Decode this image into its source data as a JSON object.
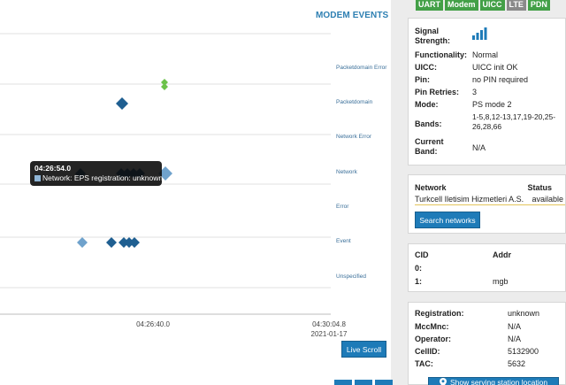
{
  "events": {
    "title": "MODEM EVENTS",
    "rows": [
      "Packetdomain Error",
      "Packetdomain",
      "Network Error",
      "Network",
      "Error",
      "Event",
      "Unspecified"
    ],
    "x_ticks": [
      "04:26:40.0",
      "04:30:04.8"
    ],
    "x_date": "2021-01-17",
    "tooltip": {
      "time": "04:26:54.0",
      "text": "Network: EPS registration: unknown"
    },
    "live_scroll": "Live Scroll",
    "colors": {
      "marker": "#1f5f91",
      "marker_light": "#6fa2cc",
      "marker_green": "#6cc24a",
      "grid": "#e2e2e2"
    }
  },
  "badges": [
    {
      "label": "UART",
      "active": true
    },
    {
      "label": "Modem",
      "active": true
    },
    {
      "label": "UICC",
      "active": true
    },
    {
      "label": "LTE",
      "active": false
    },
    {
      "label": "PDN",
      "active": true
    }
  ],
  "status": {
    "signal_label": "Signal Strength:",
    "signal_icon": "signal-bars-icon",
    "functionality_label": "Functionality:",
    "functionality": "Normal",
    "uicc_label": "UICC:",
    "uicc": "UICC init OK",
    "pin_label": "Pin:",
    "pin": "no PIN required",
    "pin_retries_label": "Pin Retries:",
    "pin_retries": "3",
    "mode_label": "Mode:",
    "mode": "PS mode 2",
    "bands_label": "Bands:",
    "bands": "1-5,8,12-13,17,19-20,25-26,28,66",
    "current_band_label": "Current Band:",
    "current_band": "N/A"
  },
  "network": {
    "network_header": "Network",
    "status_header": "Status",
    "operator": "Turkcell Iletisim Hizmetleri A.S.",
    "operator_status": "available",
    "search_button": "Search networks"
  },
  "pdn": {
    "cid_header": "CID",
    "addr_header": "Addr",
    "rows": [
      {
        "cid": "0:",
        "addr": ""
      },
      {
        "cid": "1:",
        "addr": "mgb"
      }
    ]
  },
  "registration": {
    "registration_label": "Registration:",
    "registration": "unknown",
    "mccmnc_label": "MccMnc:",
    "mccmnc": "N/A",
    "operator_label": "Operator:",
    "operator": "N/A",
    "cellid_label": "CellID:",
    "cellid": "5132900",
    "tac_label": "TAC:",
    "tac": "5632",
    "serving_button": "Show serving station location"
  }
}
